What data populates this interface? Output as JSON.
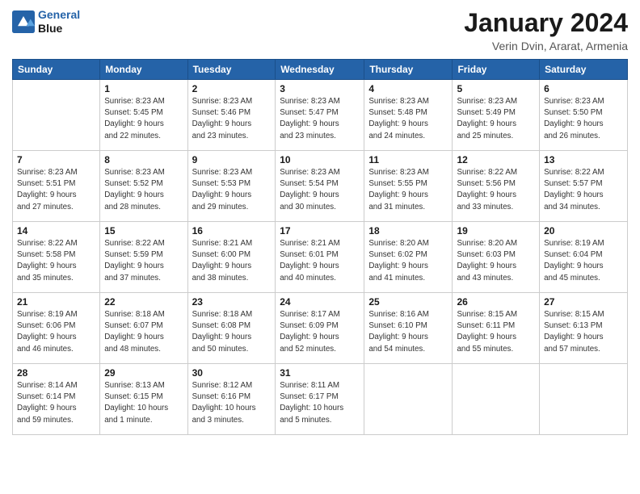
{
  "logo": {
    "line1": "General",
    "line2": "Blue"
  },
  "title": "January 2024",
  "location": "Verin Dvin, Ararat, Armenia",
  "days_of_week": [
    "Sunday",
    "Monday",
    "Tuesday",
    "Wednesday",
    "Thursday",
    "Friday",
    "Saturday"
  ],
  "weeks": [
    [
      {
        "day": "",
        "info": ""
      },
      {
        "day": "1",
        "info": "Sunrise: 8:23 AM\nSunset: 5:45 PM\nDaylight: 9 hours\nand 22 minutes."
      },
      {
        "day": "2",
        "info": "Sunrise: 8:23 AM\nSunset: 5:46 PM\nDaylight: 9 hours\nand 23 minutes."
      },
      {
        "day": "3",
        "info": "Sunrise: 8:23 AM\nSunset: 5:47 PM\nDaylight: 9 hours\nand 23 minutes."
      },
      {
        "day": "4",
        "info": "Sunrise: 8:23 AM\nSunset: 5:48 PM\nDaylight: 9 hours\nand 24 minutes."
      },
      {
        "day": "5",
        "info": "Sunrise: 8:23 AM\nSunset: 5:49 PM\nDaylight: 9 hours\nand 25 minutes."
      },
      {
        "day": "6",
        "info": "Sunrise: 8:23 AM\nSunset: 5:50 PM\nDaylight: 9 hours\nand 26 minutes."
      }
    ],
    [
      {
        "day": "7",
        "info": "Sunrise: 8:23 AM\nSunset: 5:51 PM\nDaylight: 9 hours\nand 27 minutes."
      },
      {
        "day": "8",
        "info": "Sunrise: 8:23 AM\nSunset: 5:52 PM\nDaylight: 9 hours\nand 28 minutes."
      },
      {
        "day": "9",
        "info": "Sunrise: 8:23 AM\nSunset: 5:53 PM\nDaylight: 9 hours\nand 29 minutes."
      },
      {
        "day": "10",
        "info": "Sunrise: 8:23 AM\nSunset: 5:54 PM\nDaylight: 9 hours\nand 30 minutes."
      },
      {
        "day": "11",
        "info": "Sunrise: 8:23 AM\nSunset: 5:55 PM\nDaylight: 9 hours\nand 31 minutes."
      },
      {
        "day": "12",
        "info": "Sunrise: 8:22 AM\nSunset: 5:56 PM\nDaylight: 9 hours\nand 33 minutes."
      },
      {
        "day": "13",
        "info": "Sunrise: 8:22 AM\nSunset: 5:57 PM\nDaylight: 9 hours\nand 34 minutes."
      }
    ],
    [
      {
        "day": "14",
        "info": "Sunrise: 8:22 AM\nSunset: 5:58 PM\nDaylight: 9 hours\nand 35 minutes."
      },
      {
        "day": "15",
        "info": "Sunrise: 8:22 AM\nSunset: 5:59 PM\nDaylight: 9 hours\nand 37 minutes."
      },
      {
        "day": "16",
        "info": "Sunrise: 8:21 AM\nSunset: 6:00 PM\nDaylight: 9 hours\nand 38 minutes."
      },
      {
        "day": "17",
        "info": "Sunrise: 8:21 AM\nSunset: 6:01 PM\nDaylight: 9 hours\nand 40 minutes."
      },
      {
        "day": "18",
        "info": "Sunrise: 8:20 AM\nSunset: 6:02 PM\nDaylight: 9 hours\nand 41 minutes."
      },
      {
        "day": "19",
        "info": "Sunrise: 8:20 AM\nSunset: 6:03 PM\nDaylight: 9 hours\nand 43 minutes."
      },
      {
        "day": "20",
        "info": "Sunrise: 8:19 AM\nSunset: 6:04 PM\nDaylight: 9 hours\nand 45 minutes."
      }
    ],
    [
      {
        "day": "21",
        "info": "Sunrise: 8:19 AM\nSunset: 6:06 PM\nDaylight: 9 hours\nand 46 minutes."
      },
      {
        "day": "22",
        "info": "Sunrise: 8:18 AM\nSunset: 6:07 PM\nDaylight: 9 hours\nand 48 minutes."
      },
      {
        "day": "23",
        "info": "Sunrise: 8:18 AM\nSunset: 6:08 PM\nDaylight: 9 hours\nand 50 minutes."
      },
      {
        "day": "24",
        "info": "Sunrise: 8:17 AM\nSunset: 6:09 PM\nDaylight: 9 hours\nand 52 minutes."
      },
      {
        "day": "25",
        "info": "Sunrise: 8:16 AM\nSunset: 6:10 PM\nDaylight: 9 hours\nand 54 minutes."
      },
      {
        "day": "26",
        "info": "Sunrise: 8:15 AM\nSunset: 6:11 PM\nDaylight: 9 hours\nand 55 minutes."
      },
      {
        "day": "27",
        "info": "Sunrise: 8:15 AM\nSunset: 6:13 PM\nDaylight: 9 hours\nand 57 minutes."
      }
    ],
    [
      {
        "day": "28",
        "info": "Sunrise: 8:14 AM\nSunset: 6:14 PM\nDaylight: 9 hours\nand 59 minutes."
      },
      {
        "day": "29",
        "info": "Sunrise: 8:13 AM\nSunset: 6:15 PM\nDaylight: 10 hours\nand 1 minute."
      },
      {
        "day": "30",
        "info": "Sunrise: 8:12 AM\nSunset: 6:16 PM\nDaylight: 10 hours\nand 3 minutes."
      },
      {
        "day": "31",
        "info": "Sunrise: 8:11 AM\nSunset: 6:17 PM\nDaylight: 10 hours\nand 5 minutes."
      },
      {
        "day": "",
        "info": ""
      },
      {
        "day": "",
        "info": ""
      },
      {
        "day": "",
        "info": ""
      }
    ]
  ]
}
